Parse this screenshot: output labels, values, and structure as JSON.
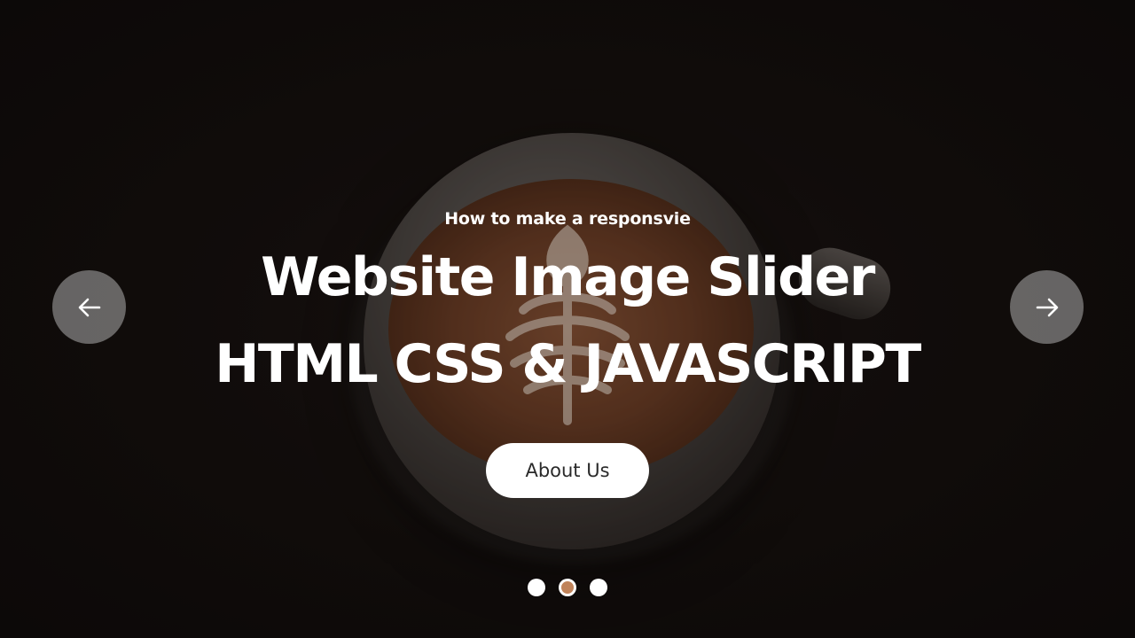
{
  "slide": {
    "subtitle": "How to make a responsvie",
    "title_line_1": "Website Image Slider",
    "title_line_2": "HTML CSS & JAVASCRIPT",
    "button_label": "About Us"
  },
  "navigation": {
    "prev_icon": "arrow-left-icon",
    "next_icon": "arrow-right-icon"
  },
  "pagination": {
    "total": 3,
    "active_index": 1
  },
  "colors": {
    "active_dot": "#c0835a",
    "nav_button": "rgba(190,190,190,0.5)",
    "button_bg": "#ffffff",
    "text": "#ffffff"
  }
}
